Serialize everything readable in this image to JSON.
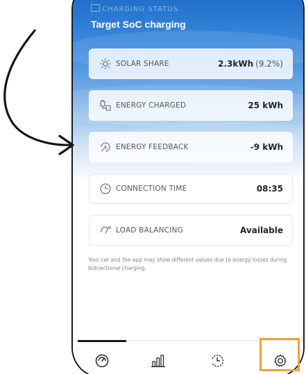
{
  "header": {
    "status_label": "CHARGING STATUS",
    "status_title": "Target SoC charging"
  },
  "cards": [
    {
      "label": "SOLAR SHARE",
      "value": "2.3kWh",
      "value_sub": "(9.2%)",
      "icon": "sun-icon"
    },
    {
      "label": "ENERGY CHARGED",
      "value": "25 kWh",
      "value_sub": "",
      "icon": "plug-icon"
    },
    {
      "label": "ENERGY FEEDBACK",
      "value": "-9 kWh",
      "value_sub": "",
      "icon": "energy-feedback-icon"
    },
    {
      "label": "CONNECTION TIME",
      "value": "08:35",
      "value_sub": "",
      "icon": "clock-icon"
    },
    {
      "label": "LOAD BALANCING",
      "value": "Available",
      "value_sub": "",
      "icon": "load-balancing-icon"
    }
  ],
  "disclaimer": "Your car and the app may show different values due to energy losses during bidirectional charging.",
  "nav": {
    "items": [
      {
        "name": "charging-gauge-icon",
        "active": true
      },
      {
        "name": "statistics-bar-chart-icon",
        "active": false
      },
      {
        "name": "history-icon",
        "active": false
      },
      {
        "name": "settings-gear-icon",
        "active": false
      }
    ]
  },
  "colors": {
    "gradient_top": "#1a63c3",
    "accent_highlight": "#e8a33d",
    "text_dark": "#1d2430",
    "text_muted": "#4f5661"
  }
}
